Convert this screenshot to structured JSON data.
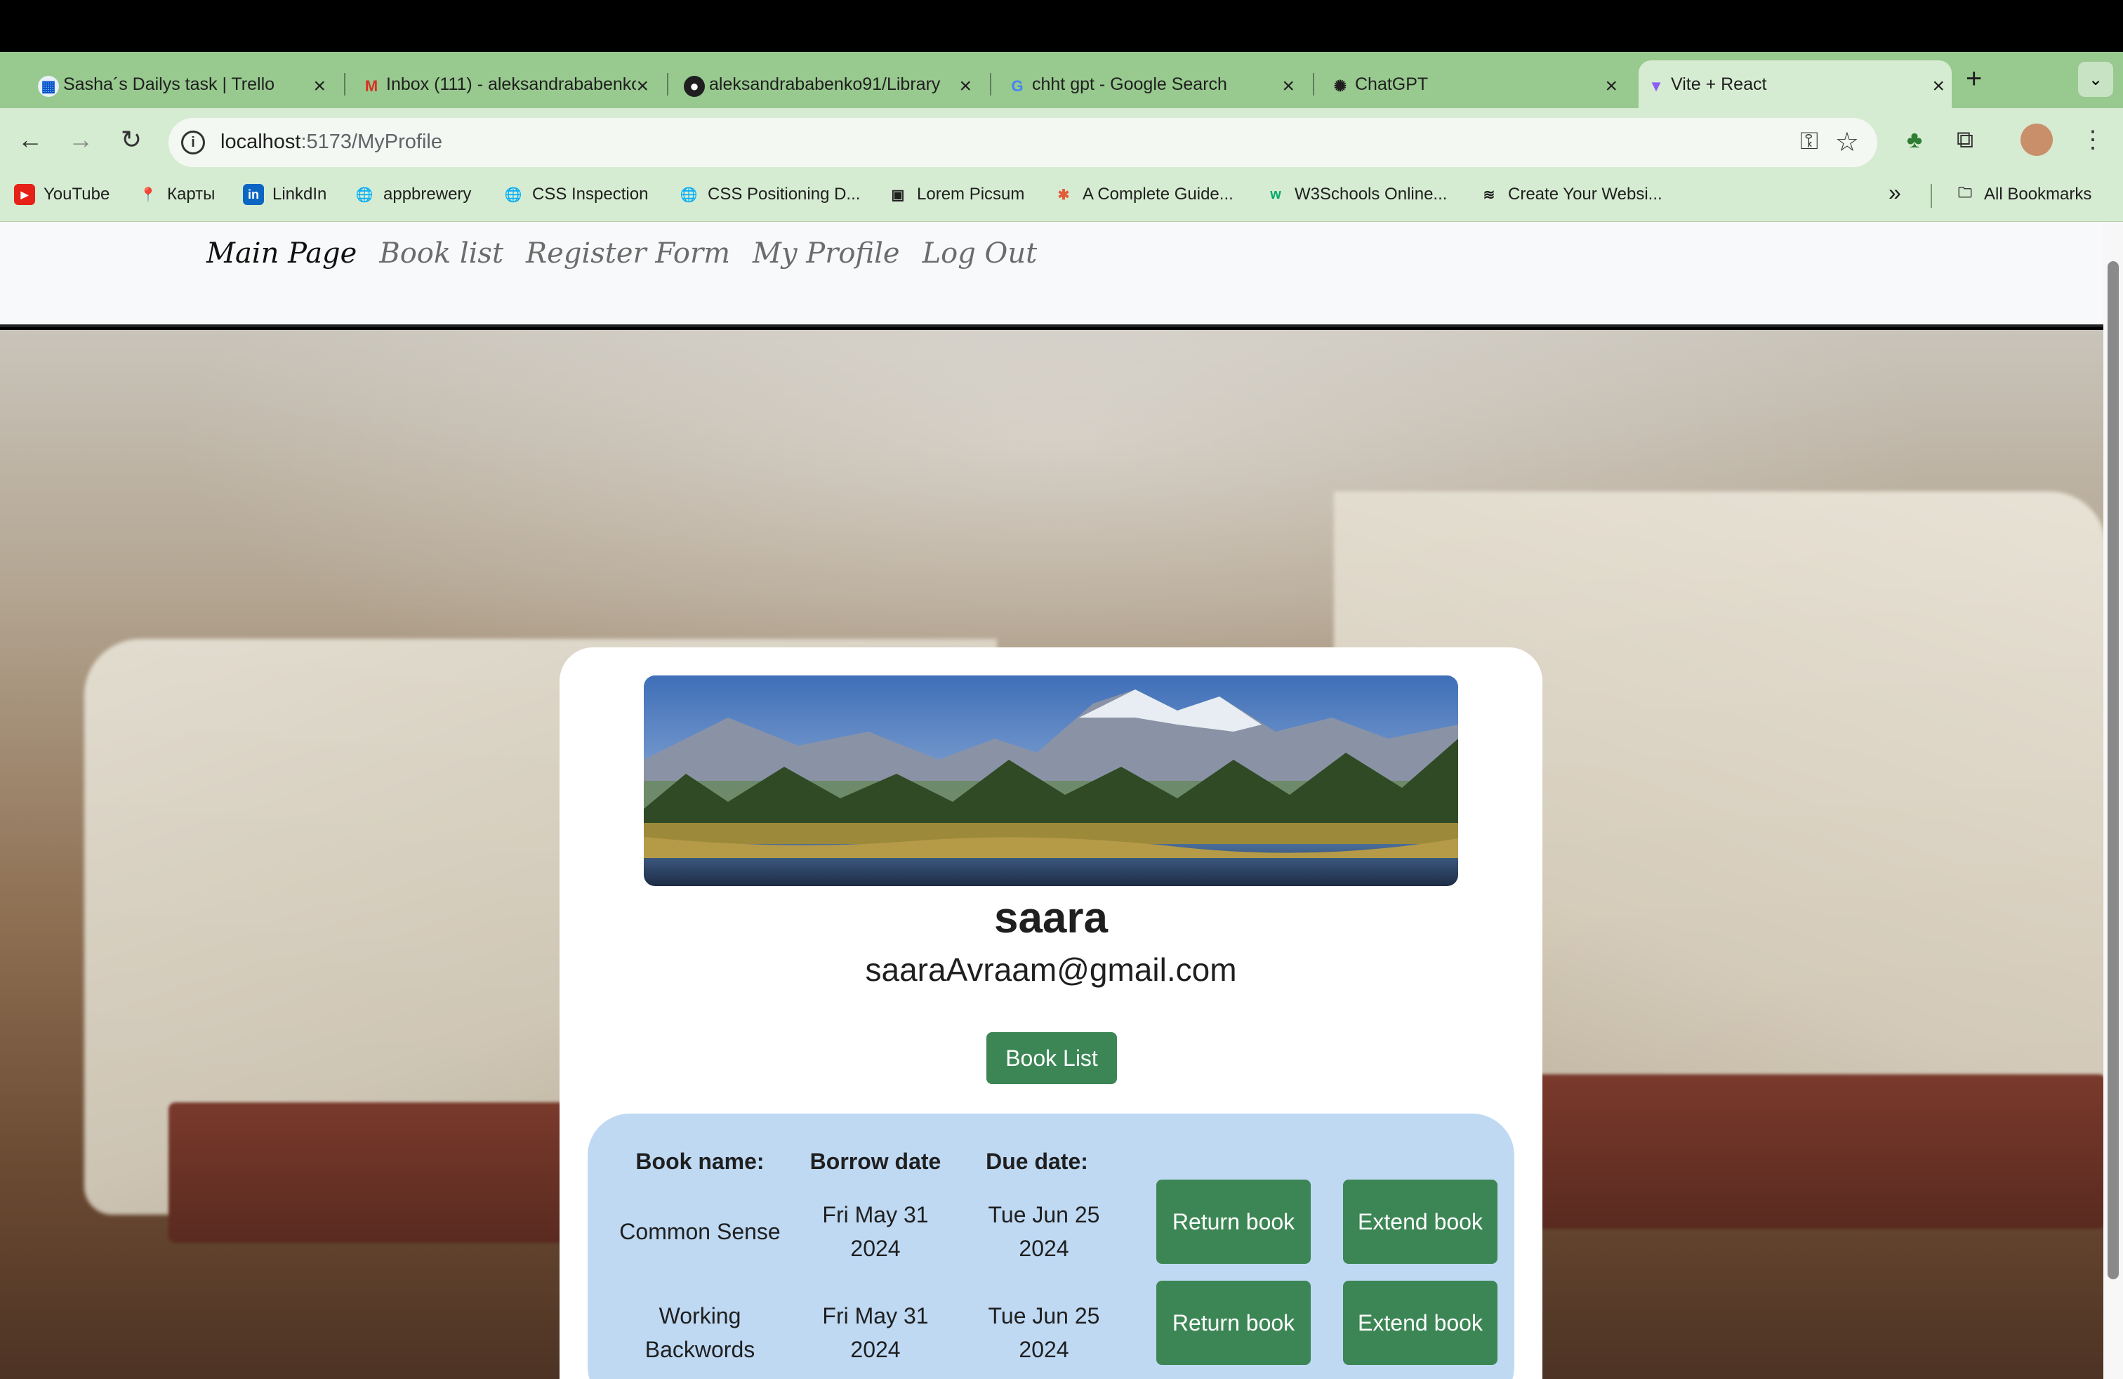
{
  "browser": {
    "tabs": [
      {
        "title": "Sasha´s Dailys task | Trello",
        "icon": "trello-icon"
      },
      {
        "title": "Inbox (111) - aleksandrababenko",
        "icon": "gmail-icon"
      },
      {
        "title": "aleksandrababenko91/Library",
        "icon": "github-icon"
      },
      {
        "title": "chht gpt - Google Search",
        "icon": "google-icon"
      },
      {
        "title": "ChatGPT",
        "icon": "chatgpt-icon"
      },
      {
        "title": "Vite + React",
        "icon": "vite-icon",
        "active": true
      }
    ],
    "new_tab": "+",
    "url_host": "localhost",
    "url_path": ":5173/MyProfile",
    "bookmarks": [
      {
        "label": "YouTube",
        "icon": "youtube-icon"
      },
      {
        "label": "Карты",
        "icon": "maps-icon"
      },
      {
        "label": "LinkdIn",
        "icon": "linkedin-icon"
      },
      {
        "label": "appbrewery",
        "icon": "globe-icon"
      },
      {
        "label": "CSS Inspection",
        "icon": "globe-icon"
      },
      {
        "label": "CSS Positioning D...",
        "icon": "globe-icon"
      },
      {
        "label": "Lorem Picsum",
        "icon": "image-icon"
      },
      {
        "label": "A Complete Guide...",
        "icon": "asterisk-icon"
      },
      {
        "label": "W3Schools Online...",
        "icon": "w3schools-icon"
      },
      {
        "label": "Create Your Websi...",
        "icon": "wix-icon"
      }
    ],
    "more_bookmarks": "»",
    "all_bookmarks": "All Bookmarks"
  },
  "nav": {
    "main_page": "Main Page",
    "book_list": "Book list",
    "register_form": "Register Form",
    "my_profile": "My Profile",
    "log_out": "Log Out"
  },
  "profile": {
    "username": "saara",
    "email": "saaraAvraam@gmail.com",
    "book_list_button": "Book List"
  },
  "table": {
    "headers": [
      "Book name:",
      "Borrow date",
      "Due date:"
    ],
    "rows": [
      {
        "name": "Common Sense",
        "borrow": "Fri May 31 2024",
        "due": "Tue Jun 25 2024"
      },
      {
        "name": "Working Backwords",
        "borrow": "Fri May 31 2024",
        "due": "Tue Jun 25 2024"
      }
    ],
    "return_label": "Return book",
    "extend_label": "Extend book"
  },
  "colors": {
    "tabstrip": "#98c98f",
    "toolbar": "#d6ecd2",
    "button_green": "#3c8655",
    "table_panel": "#bfd9f3"
  }
}
